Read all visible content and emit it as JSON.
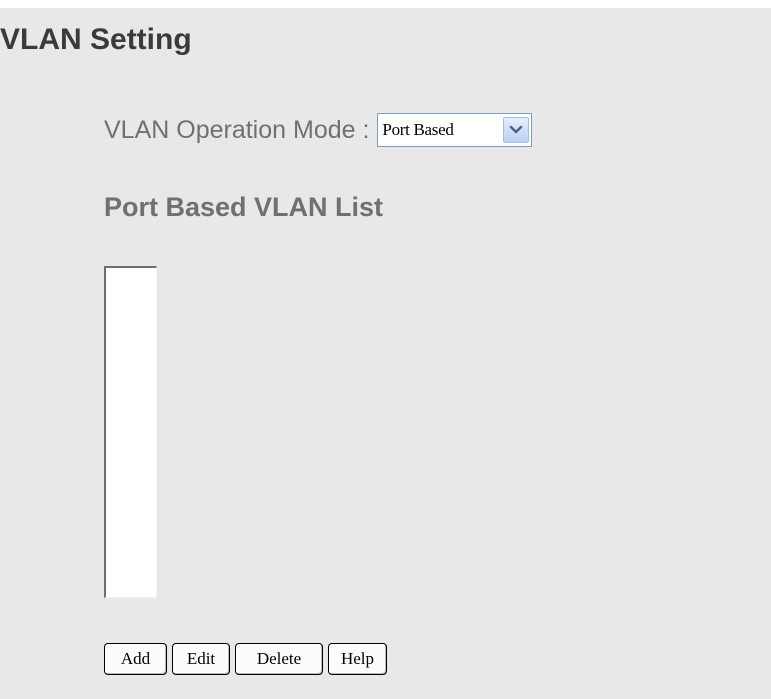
{
  "page": {
    "title": "VLAN Setting"
  },
  "operation_mode": {
    "label": "VLAN Operation Mode :",
    "selected": "Port Based",
    "arrow_icon": "chevron-down-icon"
  },
  "vlan_list": {
    "title": "Port Based VLAN List",
    "items": []
  },
  "buttons": {
    "add": "Add",
    "edit": "Edit",
    "delete": "Delete",
    "help": "Help"
  },
  "colors": {
    "background": "#e8e8e8",
    "title_text": "#3a3a3a",
    "label_text": "#707070",
    "select_border": "#7f9db9",
    "select_arrow_bg": "#bcd0f5",
    "list_background": "#ffffff"
  }
}
